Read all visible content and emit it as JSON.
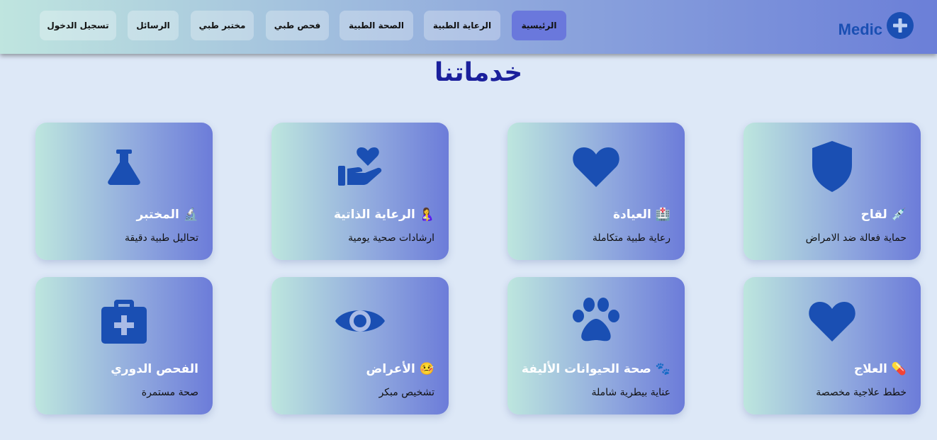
{
  "header": {
    "brand": "Medic",
    "nav": [
      {
        "label": "الرئيسية",
        "active": true
      },
      {
        "label": "الرعاية الطبية"
      },
      {
        "label": "الصحة الطبية"
      },
      {
        "label": "فحص طبي"
      },
      {
        "label": "مختبر طبي"
      },
      {
        "label": "الرسائل"
      },
      {
        "label": "تسجيل الدخول"
      }
    ]
  },
  "main": {
    "title": "خدماتنا",
    "cards": [
      {
        "icon": "shield-icon",
        "emoji": "💉",
        "title": "لقاح",
        "desc": "حماية فعالة ضد الامراض"
      },
      {
        "icon": "heart-icon",
        "emoji": "🏥",
        "title": "العيادة",
        "desc": "رعاية طبية متكاملة"
      },
      {
        "icon": "hand-holding-heart-icon",
        "emoji": "🤱",
        "title": "الرعاية الذاتية",
        "desc": "ارشادات صحية يومية"
      },
      {
        "icon": "flask-icon",
        "emoji": "🔬",
        "title": "المختبر",
        "desc": "تحاليل طبية دقيقة"
      },
      {
        "icon": "heart-icon",
        "emoji": "💊",
        "title": "العلاج",
        "desc": "خطط علاجية مخصصة"
      },
      {
        "icon": "paw-icon",
        "emoji": "🐾",
        "title": "صحة الحيوانات الأليفة",
        "desc": "عناية بيطرية شاملة"
      },
      {
        "icon": "eye-icon",
        "emoji": "🤒",
        "title": "الأعراض",
        "desc": "تشخيص مبكر"
      },
      {
        "icon": "medkit-icon",
        "emoji": "",
        "title": "الفحص الدوري",
        "desc": "صحة مستمرة"
      }
    ]
  },
  "colors": {
    "accent": "#1a4fb3",
    "title": "#1a1f9c",
    "active_nav": "#6a78dc",
    "background": "#dde8f7"
  }
}
